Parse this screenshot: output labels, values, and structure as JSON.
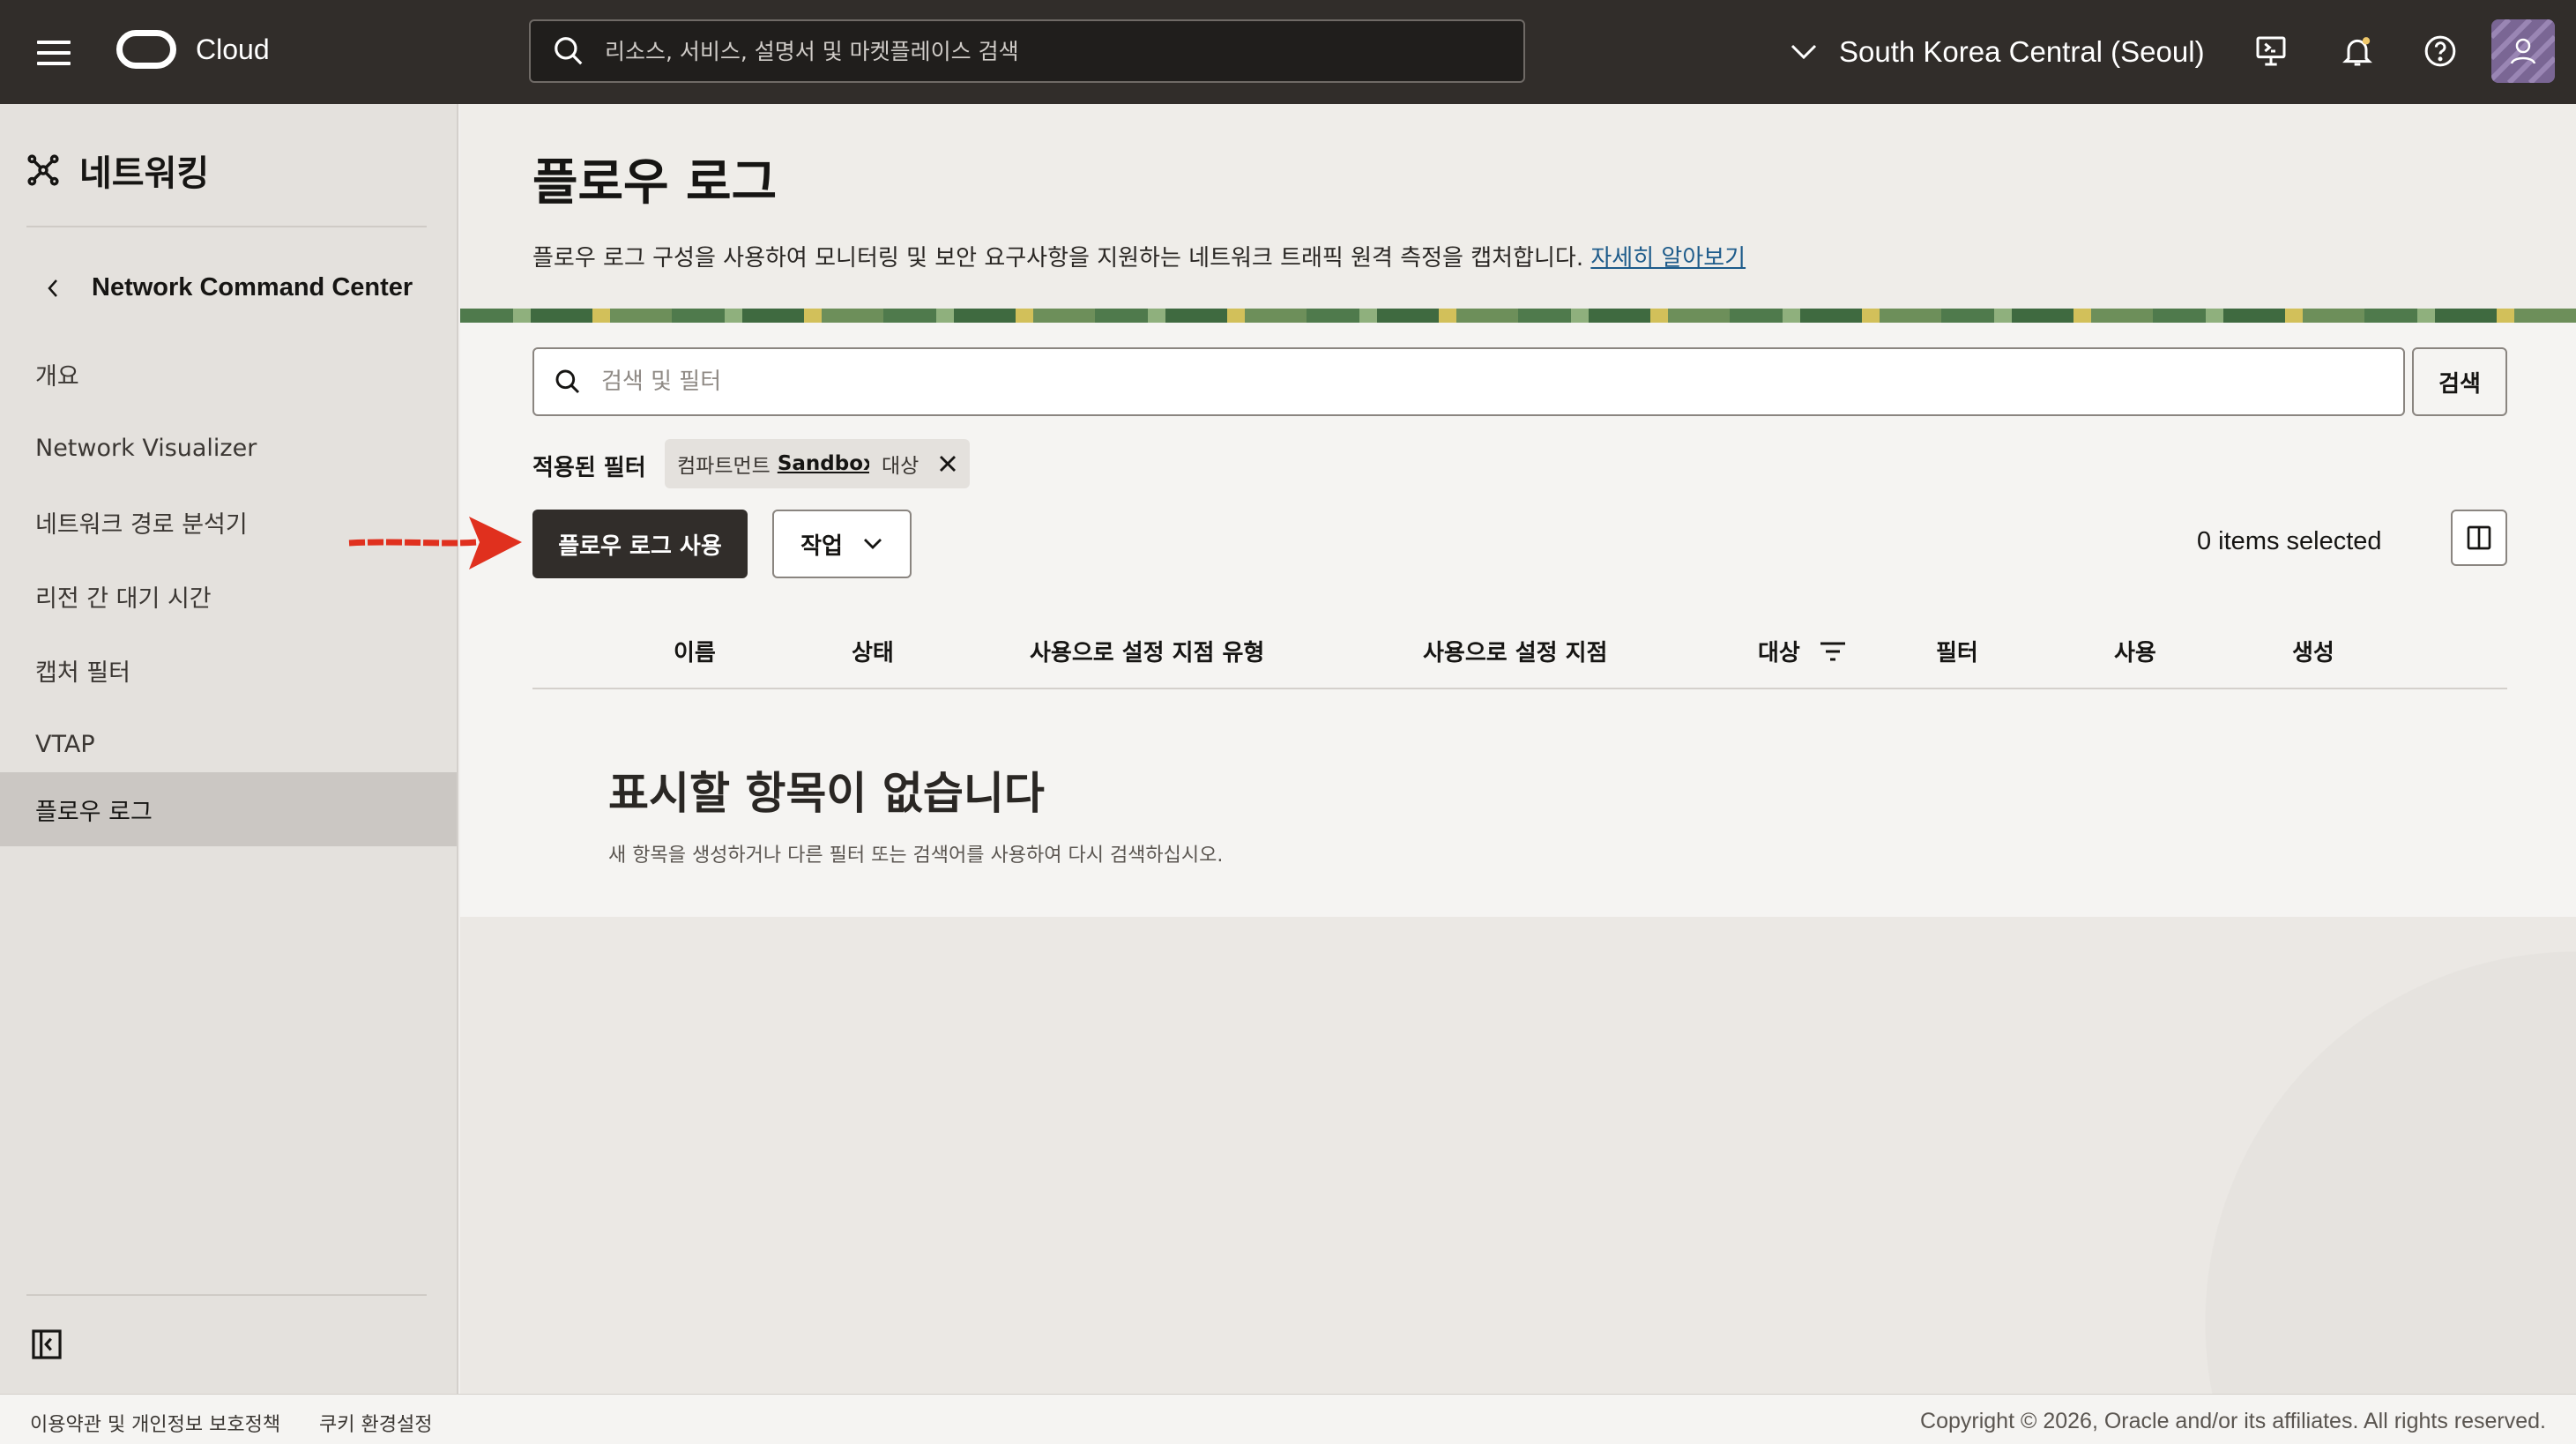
{
  "header": {
    "logo_text": "Cloud",
    "search_placeholder": "리소스, 서비스, 설명서 및 마켓플레이스 검색",
    "region": "South Korea Central (Seoul)",
    "icons": [
      "menu-icon",
      "oracle-logo-icon",
      "search-icon",
      "chevron-down-icon",
      "cloud-shell-icon",
      "bell-icon",
      "help-icon",
      "user-avatar-icon"
    ]
  },
  "sidebar": {
    "title": "네트워킹",
    "back_label": "Network Command Center",
    "items": [
      {
        "label": "개요",
        "active": false
      },
      {
        "label": "Network Visualizer",
        "active": false
      },
      {
        "label": "네트워크 경로 분석기",
        "active": false
      },
      {
        "label": "리전 간 대기 시간",
        "active": false
      },
      {
        "label": "캡처 필터",
        "active": false
      },
      {
        "label": "VTAP",
        "active": false
      },
      {
        "label": "플로우 로그",
        "active": true
      }
    ]
  },
  "main": {
    "title": "플로우 로그",
    "description": "플로우 로그 구성을 사용하여 모니터링 및 보안 요구사항을 지원하는 네트워크 트래픽 원격 측정을 캡처합니다.",
    "learn_more": "자세히 알아보기",
    "filter_placeholder": "검색 및 필터",
    "search_button": "검색",
    "applied_filters_label": "적용된 필터",
    "filter_chips": [
      {
        "key": "컴파트먼트",
        "value": "Sandbox-AI",
        "removable": false
      },
      {
        "key": "대상",
        "value": "",
        "removable": true
      }
    ],
    "enable_button": "플로우 로그 사용",
    "actions_button": "작업",
    "selected_count": "0 items selected",
    "columns": [
      "이름",
      "상태",
      "사용으로 설정 지점 유형",
      "사용으로 설정 지점",
      "대상",
      "필터",
      "사용",
      "생성"
    ],
    "empty_title": "표시할 항목이 없습니다",
    "empty_desc": "새 항목을 생성하거나 다른 필터 또는 검색어를 사용하여 다시 검색하십시오."
  },
  "footer": {
    "terms": "이용약관 및 개인정보 보호정책",
    "cookies": "쿠키 환경설정",
    "copyright": "Copyright © 2026, Oracle and/or its affiliates. All rights reserved."
  },
  "colors": {
    "header_bg": "#312d2a",
    "sidebar_bg": "#e4e1dd",
    "primary_button": "#312d2a",
    "link": "#1d5b8a",
    "annotation_arrow": "#e0301e"
  }
}
